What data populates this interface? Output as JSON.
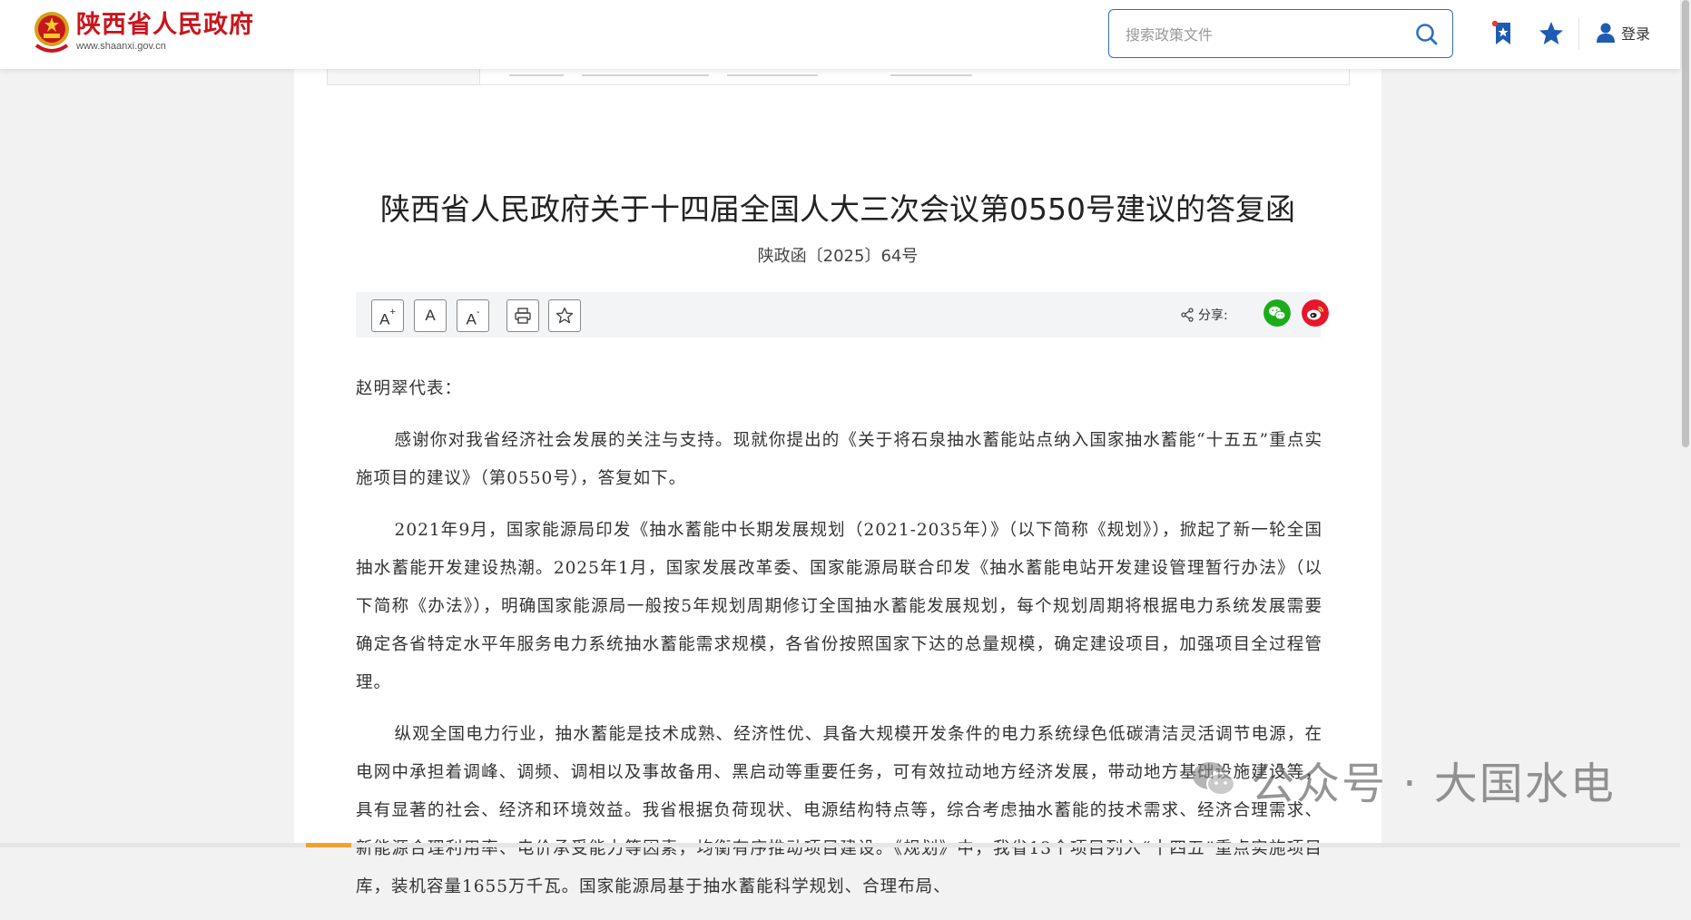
{
  "header": {
    "site_title": "陕西省人民政府",
    "site_url": "www.shaanxi.gov.cn",
    "search_placeholder": "搜索政策文件",
    "login_label": "登录"
  },
  "article": {
    "title": "陕西省人民政府关于十四届全国人大三次会议第0550号建议的答复函",
    "doc_number": "陕政函〔2025〕64号",
    "paragraphs": [
      "赵明翠代表：",
      "感谢你对我省经济社会发展的关注与支持。现就你提出的《关于将石泉抽水蓄能站点纳入国家抽水蓄能“十五五”重点实施项目的建议》（第0550号），答复如下。",
      "2021年9月，国家能源局印发《抽水蓄能中长期发展规划（2021-2035年）》（以下简称《规划》），掀起了新一轮全国抽水蓄能开发建设热潮。2025年1月，国家发展改革委、国家能源局联合印发《抽水蓄能电站开发建设管理暂行办法》（以下简称《办法》），明确国家能源局一般按5年规划周期修订全国抽水蓄能发展规划，每个规划周期将根据电力系统发展需要确定各省特定水平年服务电力系统抽水蓄能需求规模，各省份按照国家下达的总量规模，确定建设项目，加强项目全过程管理。",
      "纵观全国电力行业，抽水蓄能是技术成熟、经济性优、具备大规模开发条件的电力系统绿色低碳清洁灵活调节电源，在电网中承担着调峰、调频、调相以及事故备用、黑启动等重要任务，可有效拉动地方经济发展，带动地方基础设施建设等，具有显著的社会、经济和环境效益。我省根据负荷现状、电源结构特点等，综合考虑抽水蓄能的技术需求、经济合理需求、新能源合理利用率、电价承受能力等因素，均衡有序推动项目建设。《规划》中，我省13个项目列入“十四五”重点实施项目库，装机容量1655万千瓦。国家能源局基于抽水蓄能科学规划、合理布局、"
    ]
  },
  "toolbar": {
    "font_larger": "A",
    "font_larger_sup": "+",
    "font_normal": "A",
    "font_smaller": "A",
    "font_smaller_sup": "-",
    "share_label": "分享:"
  },
  "watermark": {
    "text": "公众号 · 大国水电"
  },
  "colors": {
    "brand_red": "#c8161d",
    "accent_blue": "#2d6fc1",
    "wechat_green": "#1aad19",
    "weibo_red": "#e6162d"
  }
}
